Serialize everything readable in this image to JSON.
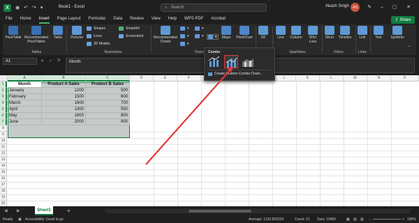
{
  "titlebar": {
    "file_name": "Book1 - Excel",
    "search_placeholder": "Search",
    "user_name": "Akash Singh",
    "user_initials": "AS"
  },
  "ribbon_tabs": [
    "File",
    "Home",
    "Insert",
    "Page Layout",
    "Formulas",
    "Data",
    "Review",
    "View",
    "Help",
    "WPS PDF",
    "Acrobat"
  ],
  "active_tab": "Insert",
  "share_label": "Share",
  "ribbon": {
    "pivottable": "PivotTable",
    "recommended_pivottables": "Recommended PivotTables",
    "table": "Table",
    "pictures": "Pictures",
    "shapes": "Shapes",
    "icons": "Icons",
    "models_3d": "3D Models",
    "smartart": "SmartArt",
    "screenshot": "Screenshot",
    "recommended_charts": "Recommended Charts",
    "maps": "Maps",
    "pivotchart": "PivotChart",
    "map_3d": "3D",
    "line": "Line",
    "column": "Column",
    "win_loss": "Win/ Loss",
    "slicer": "Slicer",
    "timeline": "Timeline",
    "link": "Link",
    "text": "Text",
    "symbols": "Symbols",
    "groups": {
      "tables": "Tables",
      "illustrations": "Illustrations",
      "charts": "Charts",
      "sparklines": "Sparklines",
      "filters": "Filters",
      "links": "Links"
    }
  },
  "combo_menu": {
    "title": "Combo",
    "create_custom": "Create Custom Combo Chart..."
  },
  "formula_bar": {
    "name_box": "A1",
    "formula": "Month"
  },
  "columns": [
    "A",
    "B",
    "C",
    "D",
    "E",
    "F",
    "G",
    "H",
    "I",
    "J",
    "K",
    "L",
    "M",
    "N",
    "O",
    "P",
    "Q",
    "R",
    "S"
  ],
  "rows": [
    "1",
    "2",
    "3",
    "4",
    "5",
    "6",
    "7",
    "8",
    "9",
    "10",
    "11",
    "12",
    "13",
    "14",
    "15",
    "16",
    "17",
    "18",
    "19",
    "20"
  ],
  "table": {
    "headers": [
      "Month",
      "Product A Sales",
      "Product B Sales"
    ],
    "rows": [
      [
        "January",
        "1200",
        "500"
      ],
      [
        "February",
        "1500",
        "600"
      ],
      [
        "March",
        "1600",
        "700"
      ],
      [
        "April",
        "1300",
        "550"
      ],
      [
        "May",
        "1600",
        "800"
      ],
      [
        "June",
        "2000",
        "900"
      ]
    ]
  },
  "sheet_tab": "Sheet1",
  "status_bar": {
    "ready": "Ready",
    "accessibility": "Accessibility: Good to go",
    "average": "Average: 1120.833333",
    "count": "Count: 21",
    "sum": "Sum: 13450",
    "zoom": "100%"
  },
  "colors": {
    "accent": "#107c41",
    "highlight": "#e23a3a",
    "selection_fill": "#c6cac8"
  }
}
